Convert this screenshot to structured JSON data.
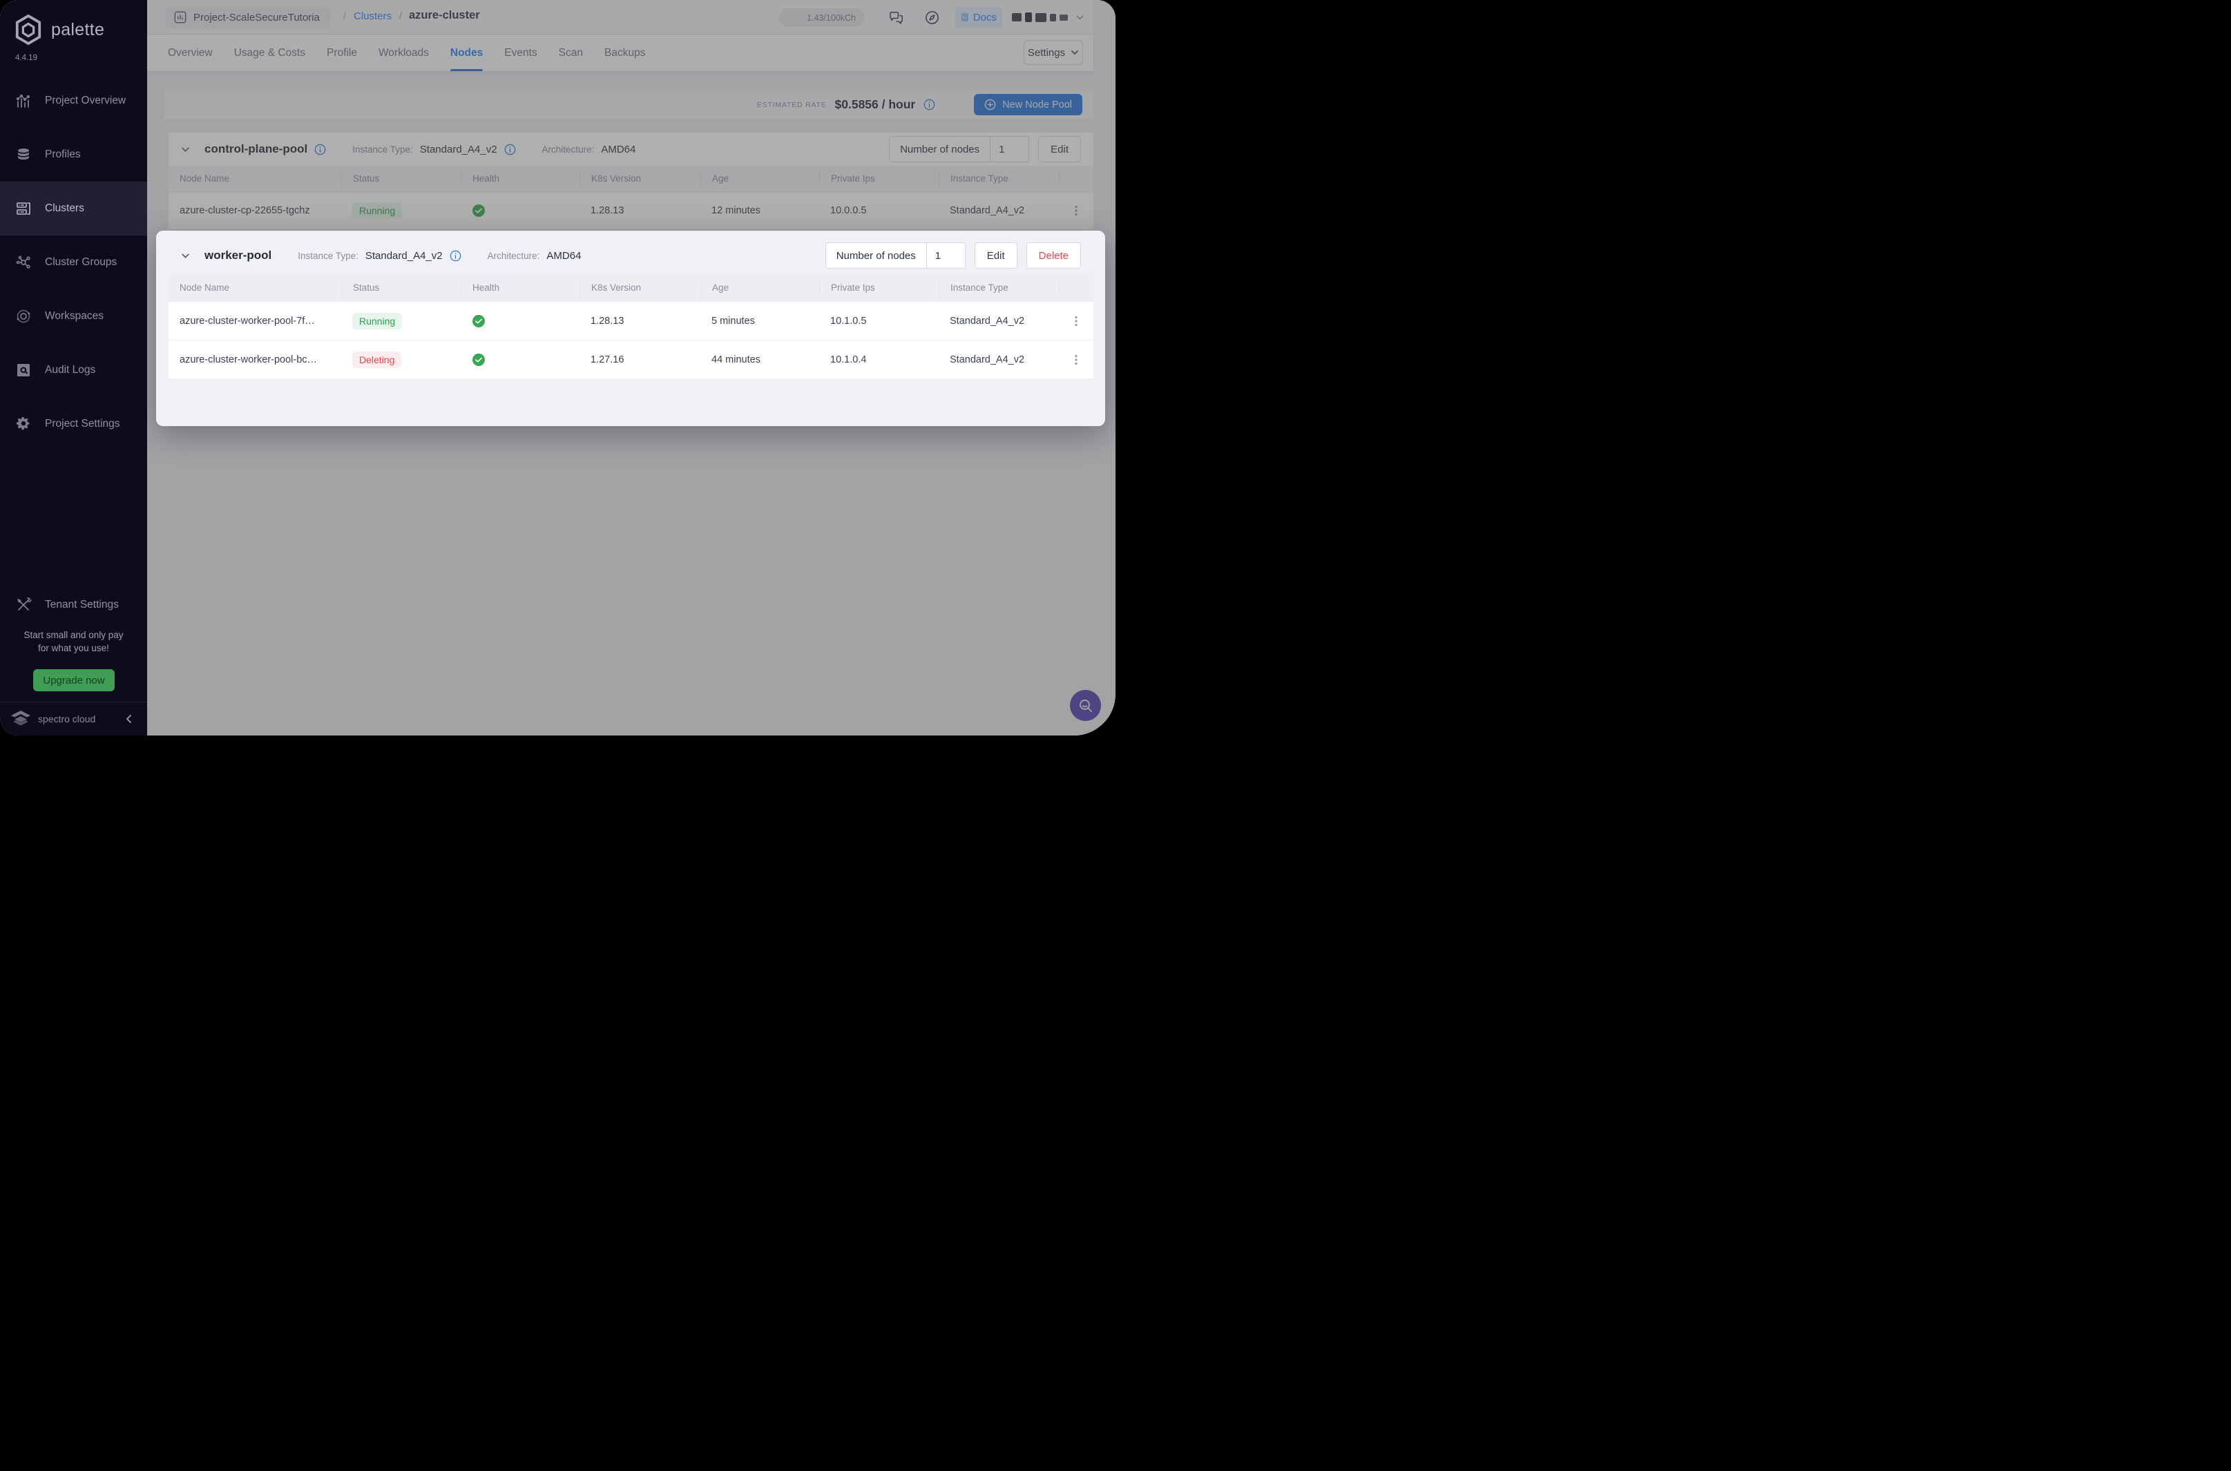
{
  "app": {
    "name": "palette",
    "version": "4.4.19"
  },
  "sidebar": {
    "items": [
      {
        "label": "Project Overview"
      },
      {
        "label": "Profiles"
      },
      {
        "label": "Clusters"
      },
      {
        "label": "Cluster Groups"
      },
      {
        "label": "Workspaces"
      },
      {
        "label": "Audit Logs"
      },
      {
        "label": "Project Settings"
      }
    ],
    "tenant_settings": "Tenant Settings",
    "promo_line1": "Start small and only pay",
    "promo_line2": "for what you use!",
    "upgrade_cta": "Upgrade now",
    "brand": "spectro cloud"
  },
  "topbar": {
    "project": "Project-ScaleSecureTutoria",
    "sep": "/",
    "breadcrumb_link": "Clusters",
    "breadcrumb_current": "azure-cluster",
    "credits": "1.43/100kCh",
    "docs": "Docs"
  },
  "tabs": {
    "items": [
      "Overview",
      "Usage & Costs",
      "Profile",
      "Workloads",
      "Nodes",
      "Events",
      "Scan",
      "Backups"
    ],
    "settings": "Settings"
  },
  "toolbar": {
    "rate_label": "ESTIMATED RATE",
    "rate_value": "$0.5856 / hour",
    "new_pool": "New Node Pool"
  },
  "labels": {
    "instance_type": "Instance Type:",
    "architecture": "Architecture:",
    "nodes_count": "Number of nodes",
    "edit": "Edit",
    "delete": "Delete"
  },
  "columns": [
    "Node Name",
    "Status",
    "Health",
    "K8s Version",
    "Age",
    "Private Ips",
    "Instance Type"
  ],
  "pools": [
    {
      "name": "control-plane-pool",
      "instance_type": "Standard_A4_v2",
      "architecture": "AMD64",
      "nodes_count": "1",
      "rows": [
        {
          "name": "azure-cluster-cp-22655-tgchz",
          "status": "Running",
          "k8s": "1.28.13",
          "age": "12 minutes",
          "ips": "10.0.0.5",
          "type": "Standard_A4_v2"
        }
      ]
    },
    {
      "name": "worker-pool",
      "instance_type": "Standard_A4_v2",
      "architecture": "AMD64",
      "nodes_count": "1",
      "rows": [
        {
          "name": "azure-cluster-worker-pool-7f…",
          "status": "Running",
          "k8s": "1.28.13",
          "age": "5 minutes",
          "ips": "10.1.0.5",
          "type": "Standard_A4_v2"
        },
        {
          "name": "azure-cluster-worker-pool-bc…",
          "status": "Deleting",
          "k8s": "1.27.16",
          "age": "44 minutes",
          "ips": "10.1.0.4",
          "type": "Standard_A4_v2"
        }
      ]
    }
  ],
  "colors": {
    "accent_blue": "#2d7ff0",
    "button_blue": "#2673d9",
    "green": "#36a852",
    "red": "#e5484d",
    "purple": "#4c3fae",
    "upgrade_green": "#3f9e53"
  }
}
